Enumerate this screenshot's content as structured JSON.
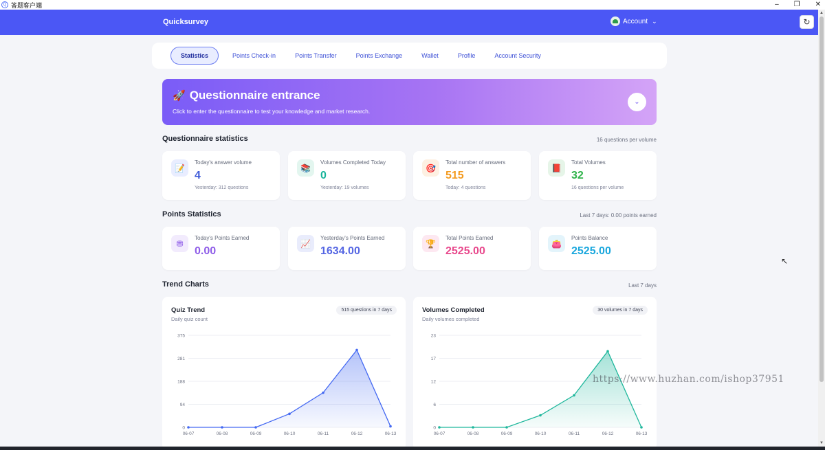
{
  "window": {
    "title": "答题客户端"
  },
  "header": {
    "brand": "Quicksurvey",
    "account_label": "Account"
  },
  "nav": {
    "tabs": [
      {
        "label": "Statistics",
        "active": true
      },
      {
        "label": "Points Check-in"
      },
      {
        "label": "Points Transfer"
      },
      {
        "label": "Points Exchange"
      },
      {
        "label": "Wallet"
      },
      {
        "label": "Profile"
      },
      {
        "label": "Account Security"
      }
    ]
  },
  "banner": {
    "title": "Questionnaire entrance",
    "subtitle": "Click to enter the questionnaire to test your knowledge and market research."
  },
  "questionnaire": {
    "title": "Questionnaire statistics",
    "note": "16 questions per volume",
    "cards": [
      {
        "icon": "notepad-icon",
        "label": "Today's answer volume",
        "value": "4",
        "sub": "Yesterday: 312 questions",
        "color": "#3f5bd8"
      },
      {
        "icon": "books-icon",
        "label": "Volumes Completed Today",
        "value": "0",
        "sub": "Yesterday: 19 volumes",
        "color": "#16b39a"
      },
      {
        "icon": "target-icon",
        "label": "Total number of answers",
        "value": "515",
        "sub": "Today: 4 questions",
        "color": "#f39a1e"
      },
      {
        "icon": "book-stack-icon",
        "label": "Total Volumes",
        "value": "32",
        "sub": "16 questions per volume",
        "color": "#2fb34a"
      }
    ]
  },
  "points": {
    "title": "Points Statistics",
    "note": "Last 7 days: 0.00 points earned",
    "cards": [
      {
        "icon": "coins-icon",
        "label": "Today's Points Earned",
        "value": "0.00",
        "color": "#8e5ce8"
      },
      {
        "icon": "trend-icon",
        "label": "Yesterday's Points Earned",
        "value": "1634.00",
        "color": "#5566e3"
      },
      {
        "icon": "trophy-icon",
        "label": "Total Points Earned",
        "value": "2525.00",
        "color": "#e8488c"
      },
      {
        "icon": "wallet-icon",
        "label": "Points Balance",
        "value": "2525.00",
        "color": "#1aa7dd"
      }
    ]
  },
  "trends": {
    "title": "Trend Charts",
    "note": "Last 7 days"
  },
  "chart_data": [
    {
      "type": "area",
      "title": "Quiz Trend",
      "subtitle": "Daily quiz count",
      "badge": "515 questions in 7 days",
      "x": [
        "06-07",
        "06-08",
        "06-09",
        "06-10",
        "06-11",
        "06-12",
        "06-13"
      ],
      "values": [
        0,
        0,
        0,
        55,
        141,
        315,
        4
      ],
      "yticks": [
        "375",
        "281",
        "188",
        "94",
        "0"
      ],
      "ylim": [
        0,
        375
      ],
      "color": "#4469f2"
    },
    {
      "type": "area",
      "title": "Volumes Completed",
      "subtitle": "Daily volumes completed",
      "badge": "30 volumes in 7 days",
      "x": [
        "06-07",
        "06-08",
        "06-09",
        "06-10",
        "06-11",
        "06-12",
        "06-13"
      ],
      "values": [
        0,
        0,
        0,
        3,
        8,
        19,
        0
      ],
      "yticks": [
        "23",
        "17",
        "12",
        "6",
        "0"
      ],
      "ylim": [
        0,
        23
      ],
      "color": "#1fb79c"
    }
  ],
  "watermark": "https://www.huzhan.com/ishop37951"
}
